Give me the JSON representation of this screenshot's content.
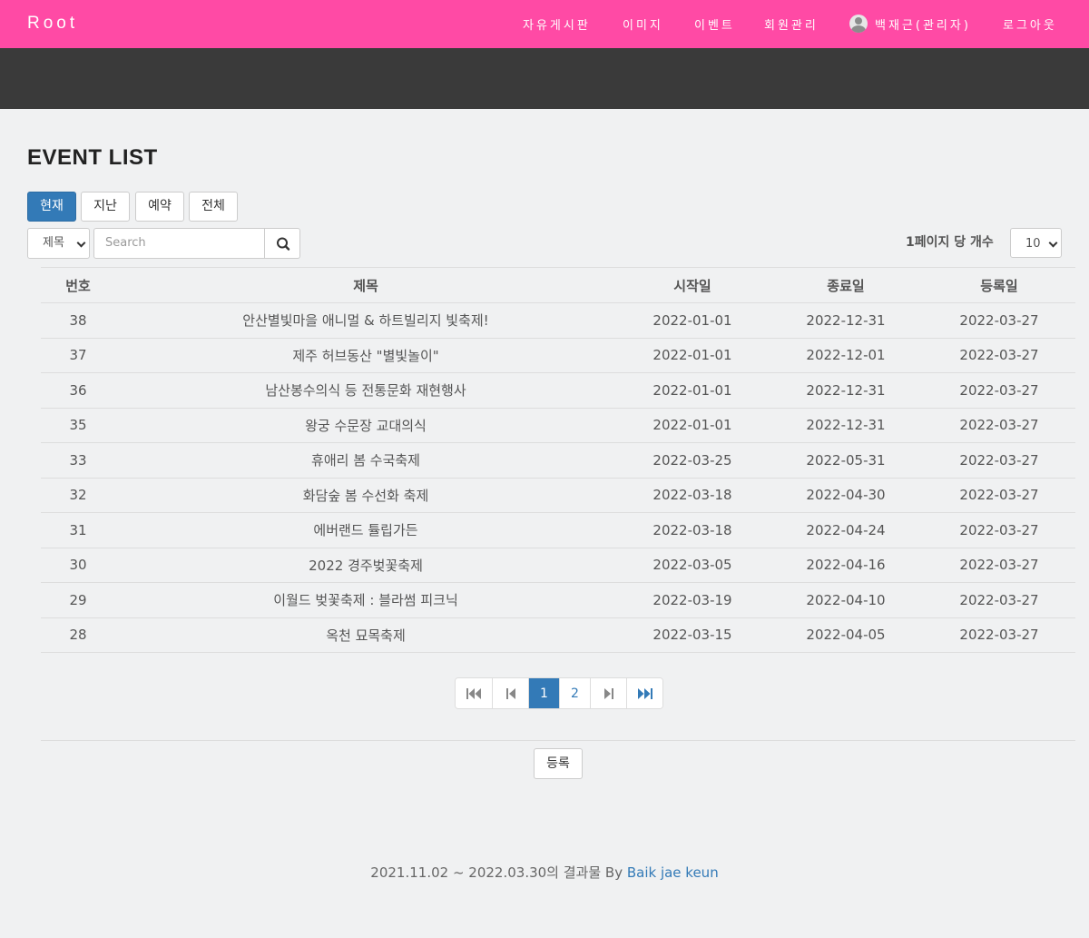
{
  "nav": {
    "brand": "Root",
    "items": [
      "자유게시판",
      "이미지",
      "이벤트",
      "회원관리"
    ],
    "user": "백재근(관리자)",
    "logout": "로그아웃"
  },
  "page": {
    "title": "EVENT LIST"
  },
  "filters": {
    "tabs": [
      {
        "label": "현재",
        "active": true
      },
      {
        "label": "지난",
        "active": false
      },
      {
        "label": "예약",
        "active": false
      },
      {
        "label": "전체",
        "active": false
      }
    ],
    "search_field_selected": "제목",
    "search_placeholder": "Search",
    "per_page_label": "1페이지 당 개수",
    "per_page_value": "10"
  },
  "table": {
    "columns": [
      "번호",
      "제목",
      "시작일",
      "종료일",
      "등록일"
    ],
    "rows": [
      [
        "38",
        "안산별빛마을 애니멀 & 하트빌리지 빛축제!",
        "2022-01-01",
        "2022-12-31",
        "2022-03-27"
      ],
      [
        "37",
        "제주 허브동산 \"별빛놀이\"",
        "2022-01-01",
        "2022-12-01",
        "2022-03-27"
      ],
      [
        "36",
        "남산봉수의식 등 전통문화 재현행사",
        "2022-01-01",
        "2022-12-31",
        "2022-03-27"
      ],
      [
        "35",
        "왕궁 수문장 교대의식",
        "2022-01-01",
        "2022-12-31",
        "2022-03-27"
      ],
      [
        "33",
        "휴애리 봄 수국축제",
        "2022-03-25",
        "2022-05-31",
        "2022-03-27"
      ],
      [
        "32",
        "화담숲 봄 수선화 축제",
        "2022-03-18",
        "2022-04-30",
        "2022-03-27"
      ],
      [
        "31",
        "에버랜드 튤립가든",
        "2022-03-18",
        "2022-04-24",
        "2022-03-27"
      ],
      [
        "30",
        "2022 경주벚꽃축제",
        "2022-03-05",
        "2022-04-16",
        "2022-03-27"
      ],
      [
        "29",
        "이월드 벚꽃축제 : 블라썸 피크닉",
        "2022-03-19",
        "2022-04-10",
        "2022-03-27"
      ],
      [
        "28",
        "옥천 묘목축제",
        "2022-03-15",
        "2022-04-05",
        "2022-03-27"
      ]
    ]
  },
  "pagination": {
    "pages": [
      "1",
      "2"
    ],
    "current": "1"
  },
  "actions": {
    "register": "등록"
  },
  "footer": {
    "text": "2021.11.02 ~ 2022.03.30의 결과물 By ",
    "author": "Baik jae keun"
  }
}
